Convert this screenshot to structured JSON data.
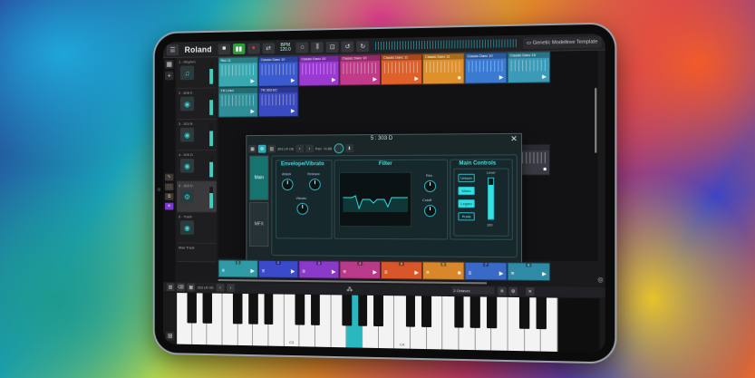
{
  "topbar": {
    "menu_icon": "menu-icon",
    "logo": "Roland",
    "bpm_label": "BPM",
    "bpm_value": "120.0",
    "template": "Genetic Modeltree Template"
  },
  "sidebar": {
    "grid_btn": "▦",
    "add_btn": "+",
    "tools": [
      "✎",
      "⬚",
      "⧉",
      "≡"
    ]
  },
  "tracks": [
    {
      "num": "1",
      "name": "1 - Rhythm",
      "icon": "♫"
    },
    {
      "num": "2",
      "name": "2 - 808 K",
      "icon": "◉"
    },
    {
      "num": "3",
      "name": "3 - 303 B",
      "icon": "◉"
    },
    {
      "num": "4",
      "name": "4 - 909 D",
      "icon": "◉"
    },
    {
      "num": "5",
      "name": "5 - 303 D",
      "icon": "⚙"
    },
    {
      "num": "6",
      "name": "6 - Track",
      "icon": "◉"
    },
    {
      "num": "7",
      "name": "Mas Track",
      "icon": "◉"
    }
  ],
  "clips_row1": [
    "Rec 11",
    "Classic Danc 10",
    "Classic Danc 10",
    "Classic Danc 10",
    "Classic Danc 11",
    "Classic Danc 11",
    "Classic Danc 10",
    "Classic Danc 10"
  ],
  "clips_row2": [
    "TR Lmtd",
    "TR 303 DC"
  ],
  "clip_side": "303 DC",
  "modal": {
    "title": "5 : 303 D",
    "preset": "303 LR OE",
    "pad_label": "Pad",
    "pad_value": "+0.8B",
    "tab_main": "Main",
    "tab_mfx": "MFX",
    "env_title": "Envelope/Vibrato",
    "attack": "Attack",
    "release": "Release",
    "vibrato": "Vibrato",
    "filter_title": "Filter",
    "res": "Res",
    "cutoff": "Cutoff",
    "main_controls": "Main Controls",
    "unison": "Unison",
    "mono": "Mono",
    "legato": "Legato",
    "porta": "Porta",
    "level": "Level",
    "level_value": "100"
  },
  "scenes": [
    "1",
    "2",
    "3",
    "4",
    "5",
    "6",
    "7",
    "8"
  ],
  "keyboard": {
    "preset": "303 LR OE",
    "octave": "2 Octaves",
    "key_c3": "C3",
    "key_c4": "C4"
  },
  "level_fraction": 0.85,
  "colors": {
    "accent": "#2fe3e3",
    "play": "#2f9e3a",
    "record": "#e23a3a"
  }
}
